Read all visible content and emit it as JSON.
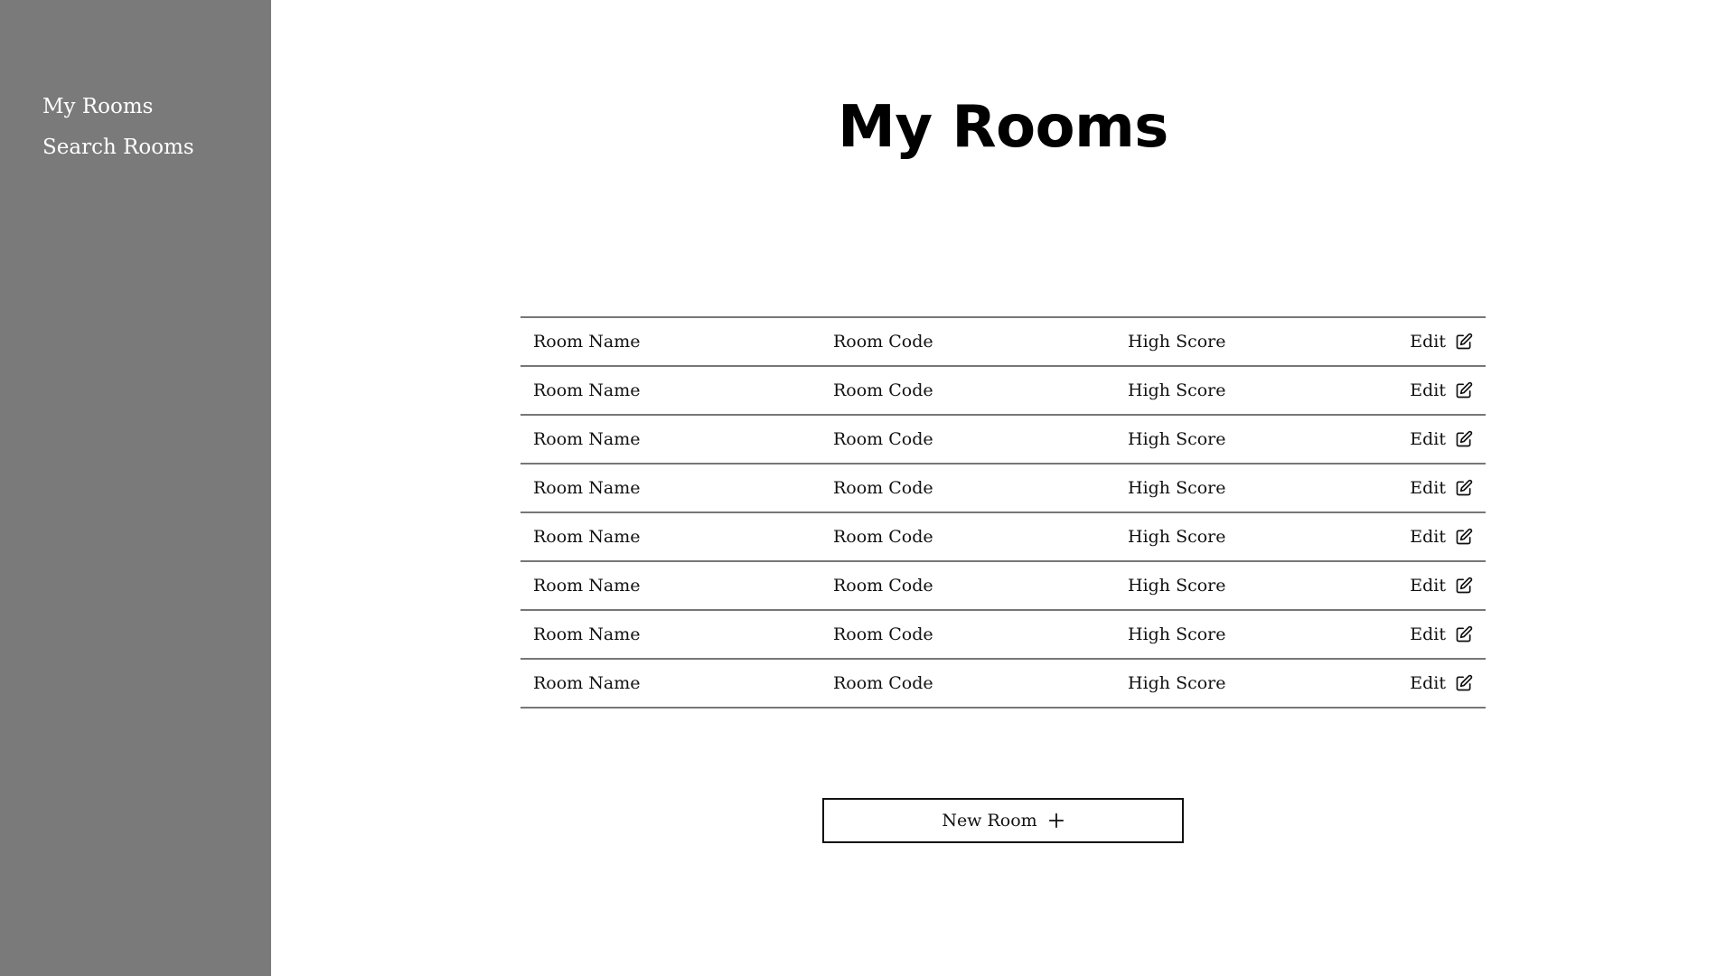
{
  "sidebar": {
    "items": [
      {
        "label": "My Rooms"
      },
      {
        "label": "Search Rooms"
      }
    ]
  },
  "main": {
    "title": "My Rooms",
    "rows": [
      {
        "name": "Room Name",
        "code": "Room Code",
        "score": "High Score",
        "edit": "Edit",
        "icon": "edit-icon"
      },
      {
        "name": "Room Name",
        "code": "Room Code",
        "score": "High Score",
        "edit": "Edit",
        "icon": "edit-icon"
      },
      {
        "name": "Room Name",
        "code": "Room Code",
        "score": "High Score",
        "edit": "Edit",
        "icon": "edit-icon"
      },
      {
        "name": "Room Name",
        "code": "Room Code",
        "score": "High Score",
        "edit": "Edit",
        "icon": "edit-icon"
      },
      {
        "name": "Room Name",
        "code": "Room Code",
        "score": "High Score",
        "edit": "Edit",
        "icon": "edit-icon"
      },
      {
        "name": "Room Name",
        "code": "Room Code",
        "score": "High Score",
        "edit": "Edit",
        "icon": "edit-icon"
      },
      {
        "name": "Room Name",
        "code": "Room Code",
        "score": "High Score",
        "edit": "Edit",
        "icon": "edit-icon"
      },
      {
        "name": "Room Name",
        "code": "Room Code",
        "score": "High Score",
        "edit": "Edit",
        "icon": "edit-icon"
      }
    ],
    "new_room_button": {
      "label": "New Room",
      "icon": "plus-icon"
    }
  },
  "colors": {
    "sidebar_bg": "#7a7a7a",
    "sidebar_text": "#ffffff",
    "divider": "#777777",
    "text": "#111111"
  }
}
